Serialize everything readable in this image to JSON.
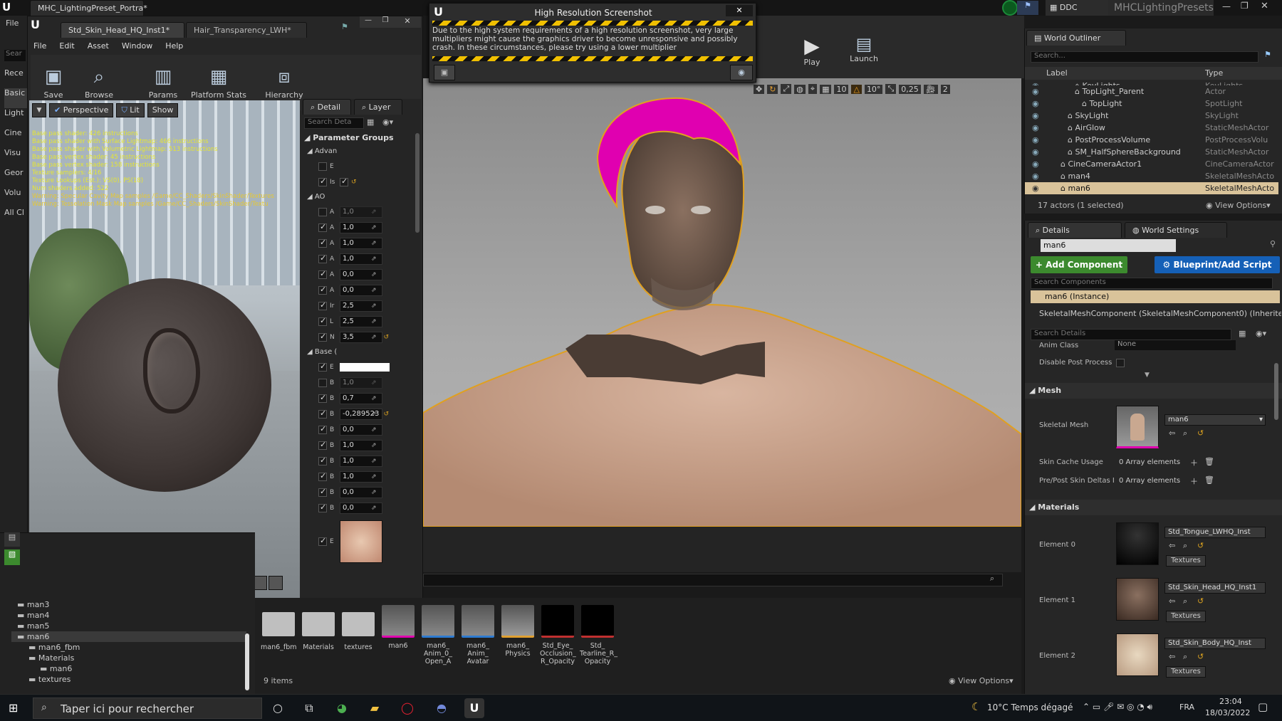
{
  "app": {
    "top_tab": "MHC_LightingPreset_Portra*",
    "project": "MHCLightingPresets",
    "ddc": "DDC",
    "menu_file": "File",
    "left_search": "Sear"
  },
  "left_strip": [
    "Rece",
    "Basic",
    "Light",
    "Cine",
    "Visu",
    "Geor",
    "Volu",
    "All Cl"
  ],
  "mat_editor": {
    "tabs": [
      "Std_Skin_Head_HQ_Inst1*",
      "Hair_Transparency_LWH*"
    ],
    "menu": [
      "File",
      "Edit",
      "Asset",
      "Window",
      "Help"
    ],
    "toolbar": [
      {
        "icon": "save-icon",
        "label": "Save"
      },
      {
        "icon": "browse-icon",
        "label": "Browse"
      },
      {
        "icon": "params-icon",
        "label": "Params"
      },
      {
        "icon": "platform-stats-icon",
        "label": "Platform Stats"
      },
      {
        "icon": "hierarchy-icon",
        "label": "Hierarchy"
      }
    ],
    "viewport_buttons": [
      "Perspective",
      "Lit",
      "Show"
    ],
    "stats": [
      {
        "text": "Base pass shader: 426 instructions",
        "color": "#e6e632"
      },
      {
        "text": "Base pass shader with Surface Lightmap: 466 instructions",
        "color": "#e6e632"
      },
      {
        "text": "Base pass shader with Volumetric Lightmap: 513 instructions",
        "color": "#e6e632"
      },
      {
        "text": "Base pass vertex shader: 45 instructions",
        "color": "#e6e632"
      },
      {
        "text": "Base pass vertex shader: 158 instructions",
        "color": "#e6e632"
      },
      {
        "text": "Texture samplers: 4/16",
        "color": "#e6e632"
      },
      {
        "text": "Texture Lookups (Est.): VS(0), PS(18)",
        "color": "#e6e632"
      },
      {
        "text": "Num shaders added: 522",
        "color": "#e6e632"
      },
      {
        "text": "Warning: Specular Cavity Map samples /Game/CC_Shaders/SkinShader/Textures",
        "color": "#e6c832"
      },
      {
        "text": "Warning: Tesselation Mask Map samples /Game/CC_Shaders/SkinShader/Textu",
        "color": "#e6c832"
      }
    ],
    "detail_tabs": [
      "Detail",
      "Layer"
    ],
    "search_placeholder": "Search Deta",
    "param_groups_title": "Parameter Groups",
    "groups": [
      {
        "name": "Advan",
        "rows": [
          {
            "check": false,
            "label": "E",
            "val": null
          },
          {
            "check": true,
            "label": "Is",
            "val": "check"
          }
        ]
      },
      {
        "name": "AO",
        "rows": [
          {
            "check": false,
            "label": "A",
            "val": "1,0"
          },
          {
            "check": true,
            "label": "A",
            "val": "1,0"
          },
          {
            "check": true,
            "label": "A",
            "val": "1,0"
          },
          {
            "check": true,
            "label": "A",
            "val": "1,0"
          },
          {
            "check": true,
            "label": "A",
            "val": "0,0"
          },
          {
            "check": true,
            "label": "A",
            "val": "0,0"
          },
          {
            "check": true,
            "label": "Ir",
            "val": "2,5"
          },
          {
            "check": true,
            "label": "L",
            "val": "2,5"
          },
          {
            "check": true,
            "label": "N",
            "val": "3,5"
          }
        ]
      },
      {
        "name": "Base (",
        "rows": [
          {
            "check": true,
            "label": "E",
            "val": "white"
          },
          {
            "check": false,
            "label": "B",
            "val": "1,0"
          },
          {
            "check": true,
            "label": "B",
            "val": "0,7"
          },
          {
            "check": true,
            "label": "B",
            "val": "-0,289523"
          },
          {
            "check": true,
            "label": "B",
            "val": "0,0"
          },
          {
            "check": true,
            "label": "B",
            "val": "1,0"
          },
          {
            "check": true,
            "label": "B",
            "val": "1,0"
          },
          {
            "check": true,
            "label": "B",
            "val": "1,0"
          },
          {
            "check": true,
            "label": "B",
            "val": "0,0"
          },
          {
            "check": true,
            "label": "B",
            "val": "0,0"
          },
          {
            "check": true,
            "label": "E",
            "val": "tex"
          }
        ]
      }
    ]
  },
  "dialog": {
    "title": "High Resolution Screenshot",
    "message": "Due to the high system requirements of a high resolution screenshot, very large multipliers might cause the graphics driver to become unresponsive and possibly crash. In these circumstances, please try using a lower multiplier"
  },
  "main_toolbar": {
    "play": "Play",
    "launch": "Launch",
    "snap": [
      "10",
      "10°",
      "0,25",
      "2"
    ]
  },
  "outliner": {
    "title": "World Outliner",
    "search_placeholder": "Search...",
    "col_label": "Label",
    "col_type": "Type",
    "rows": [
      {
        "label": "KeyLights",
        "type": "KeyLights",
        "indent": 3,
        "partial": true
      },
      {
        "label": "TopLight_Parent",
        "type": "Actor",
        "indent": 3
      },
      {
        "label": "TopLight",
        "type": "SpotLight",
        "indent": 4
      },
      {
        "label": "SkyLight",
        "type": "SkyLight",
        "indent": 2
      },
      {
        "label": "AirGlow",
        "type": "StaticMeshActor",
        "indent": 2
      },
      {
        "label": "PostProcessVolume",
        "type": "PostProcessVolu",
        "indent": 2
      },
      {
        "label": "SM_HalfSphereBackground",
        "type": "StaticMeshActor",
        "indent": 2
      },
      {
        "label": "CineCameraActor1",
        "type": "CineCameraActor",
        "indent": 1
      },
      {
        "label": "man4",
        "type": "SkeletalMeshActo",
        "indent": 1
      },
      {
        "label": "man6",
        "type": "SkeletalMeshActo",
        "indent": 1,
        "selected": true
      }
    ],
    "footer": "17 actors (1 selected)",
    "view_options": "View Options"
  },
  "details": {
    "tabs": [
      "Details",
      "World Settings"
    ],
    "name": "man6",
    "add_component": "+ Add Component",
    "blueprint": "Blueprint/Add Script",
    "search_components": "Search Components",
    "instance": "man6 (Instance)",
    "component": "SkeletalMeshComponent (SkeletalMeshComponent0) (Inherited)",
    "search_details": "Search Details",
    "anim_class_label": "Anim Class",
    "anim_class_value": "None",
    "disable_pp": "Disable Post Process",
    "mesh_section": "Mesh",
    "skeletal_mesh_label": "Skeletal Mesh",
    "skeletal_mesh_value": "man6",
    "skin_cache_label": "Skin Cache Usage",
    "skin_cache_value": "0 Array elements",
    "prepost_label": "Pre/Post Skin Deltas I",
    "prepost_value": "0 Array elements",
    "materials_section": "Materials",
    "elements": [
      {
        "label": "Element 0",
        "mat": "Std_Tongue_LWHQ_Inst",
        "btn": "Textures"
      },
      {
        "label": "Element 1",
        "mat": "Std_Skin_Head_HQ_Inst1",
        "btn": "Textures"
      },
      {
        "label": "Element 2",
        "mat": "Std_Skin_Body_HQ_Inst",
        "btn": "Textures"
      }
    ]
  },
  "folders": [
    "man3",
    "man4",
    "man5",
    "man6",
    "man6_fbm",
    "Materials",
    "man6",
    "textures"
  ],
  "content": {
    "items": [
      {
        "label": "man6_fbm",
        "kind": "folder"
      },
      {
        "label": "Materials",
        "kind": "folder"
      },
      {
        "label": "textures",
        "kind": "folder"
      },
      {
        "label": "man6",
        "kind": "mesh"
      },
      {
        "label": "man6_ Anim_0_ Open_A",
        "kind": "anim"
      },
      {
        "label": "man6_ Anim_ Avatar",
        "kind": "anim"
      },
      {
        "label": "man6_ Physics",
        "kind": "phys"
      },
      {
        "label": "Std_Eye_ Occlusion_ R_Opacity",
        "kind": "black"
      },
      {
        "label": "Std_ Tearline_R_ Opacity",
        "kind": "black"
      }
    ],
    "count": "9 items",
    "view_options": "View Options"
  },
  "taskbar": {
    "search": "Taper ici pour rechercher",
    "weather": "10°C  Temps dégagé",
    "lang": "FRA",
    "time": "23:04",
    "date": "18/03/2022"
  },
  "colors": {
    "accent": "#1560b7",
    "selection": "#d9c39a",
    "hair": "#e000b0",
    "warning_stripe": "#f0c000"
  }
}
